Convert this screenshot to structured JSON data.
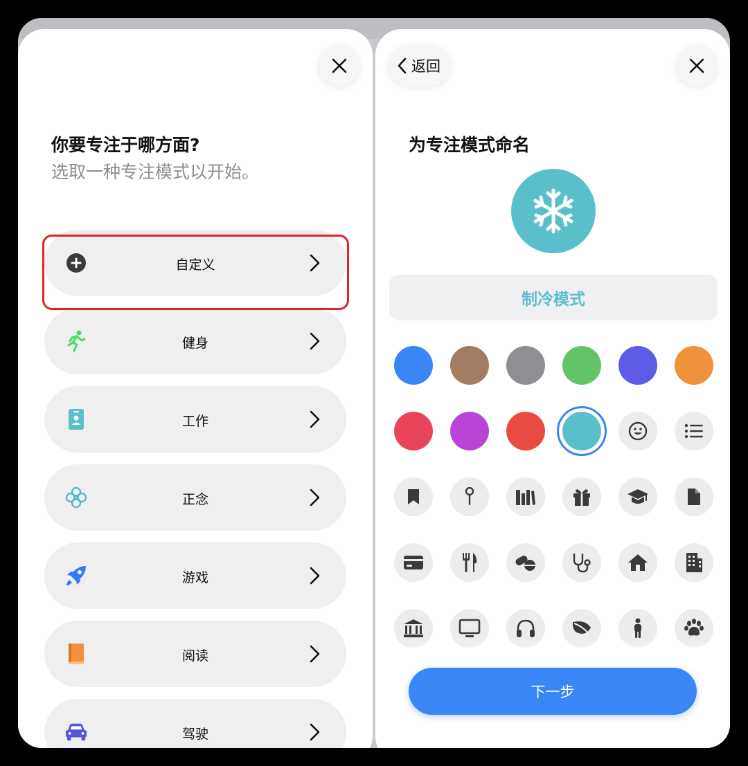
{
  "left_panel": {
    "title": "你要专注于哪方面?",
    "subtitle": "选取一种专注模式以开始。",
    "close_icon": "close-icon",
    "items": [
      {
        "label": "自定义",
        "icon": "add-circle-icon",
        "color": "#3a3a3c"
      },
      {
        "label": "健身",
        "icon": "running-icon",
        "color": "#4cd964"
      },
      {
        "label": "工作",
        "icon": "badge-icon",
        "color": "#5bbfcb"
      },
      {
        "label": "正念",
        "icon": "flower-icon",
        "color": "#5bbfcb"
      },
      {
        "label": "游戏",
        "icon": "rocket-icon",
        "color": "#2f7cf6"
      },
      {
        "label": "阅读",
        "icon": "book-icon",
        "color": "#f0923c"
      },
      {
        "label": "驾驶",
        "icon": "car-icon",
        "color": "#5856d6"
      }
    ],
    "highlight_color": "#e0242b"
  },
  "right_panel": {
    "back_label": "返回",
    "title": "为专注模式命名",
    "focus_name": "制冷模式",
    "selected_icon": "snowflake-icon",
    "accent_color": "#5bbfcb",
    "next_label": "下一步",
    "colors": [
      "#3a86f6",
      "#a27d62",
      "#8e8e93",
      "#62c466",
      "#5e5ce6",
      "#f0923c",
      "#e8455b",
      "#b944d6",
      "#e84c43",
      "#5bbfcb"
    ],
    "selected_color_index": 9,
    "icons": [
      "smiley-icon",
      "list-icon",
      "bookmark-icon",
      "pin-icon",
      "books-icon",
      "gift-icon",
      "graduation-cap-icon",
      "document-icon",
      "credit-card-icon",
      "fork-knife-icon",
      "pills-icon",
      "stethoscope-icon",
      "house-icon",
      "building-icon",
      "bank-icon",
      "monitor-icon",
      "headphones-icon",
      "leaf-icon",
      "person-icon",
      "paw-icon"
    ]
  }
}
